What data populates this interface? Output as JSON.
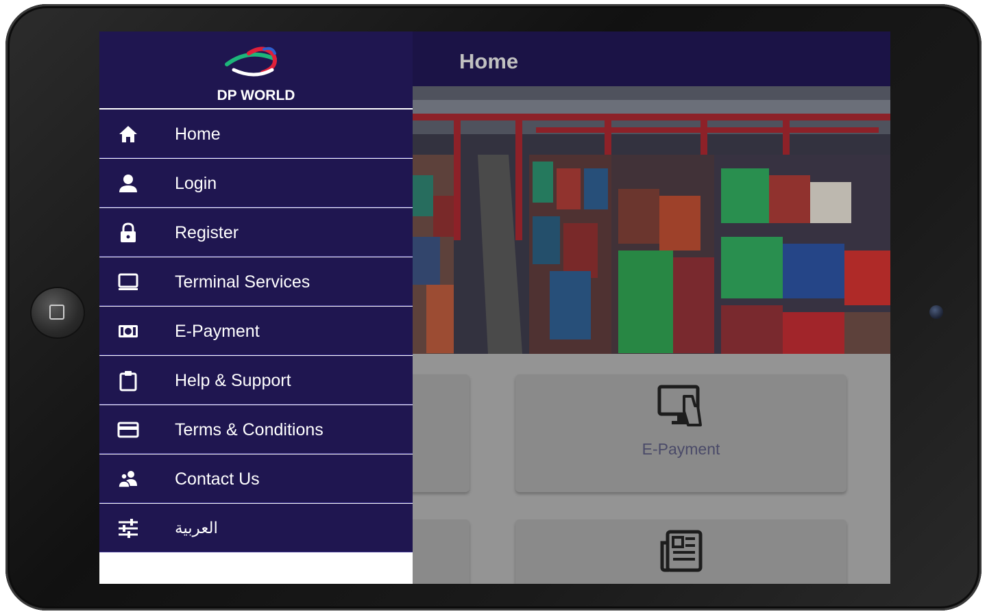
{
  "app": {
    "brand_name": "DP WORLD",
    "logo_icon": "dp-world-logo-icon",
    "colors": {
      "primary": "#1f1650",
      "menu_divider": "#3c3290",
      "logo_red": "#e0203a",
      "logo_green": "#1db67a",
      "logo_blue": "#2d5fd0"
    }
  },
  "header": {
    "title": "Home"
  },
  "drawer": {
    "items": [
      {
        "label": "Home",
        "icon": "home-icon"
      },
      {
        "label": "Login",
        "icon": "person-icon"
      },
      {
        "label": "Register",
        "icon": "lock-icon"
      },
      {
        "label": "Terminal Services",
        "icon": "monitor-icon"
      },
      {
        "label": "E-Payment",
        "icon": "money-icon"
      },
      {
        "label": "Help & Support",
        "icon": "clipboard-icon"
      },
      {
        "label": "Terms & Conditions",
        "icon": "credit-card-icon"
      },
      {
        "label": "Contact Us",
        "icon": "people-icon"
      },
      {
        "label": "العربية",
        "icon": "sliders-icon"
      }
    ]
  },
  "main": {
    "hero_image": "container-port-photo",
    "cards": [
      {
        "label": "E-Payment",
        "icon": "e-payment-icon"
      },
      {
        "label": "",
        "icon": "newspaper-icon"
      }
    ]
  },
  "device": {
    "home_button_icon": "home-button-icon",
    "camera_icon": "camera-icon"
  }
}
